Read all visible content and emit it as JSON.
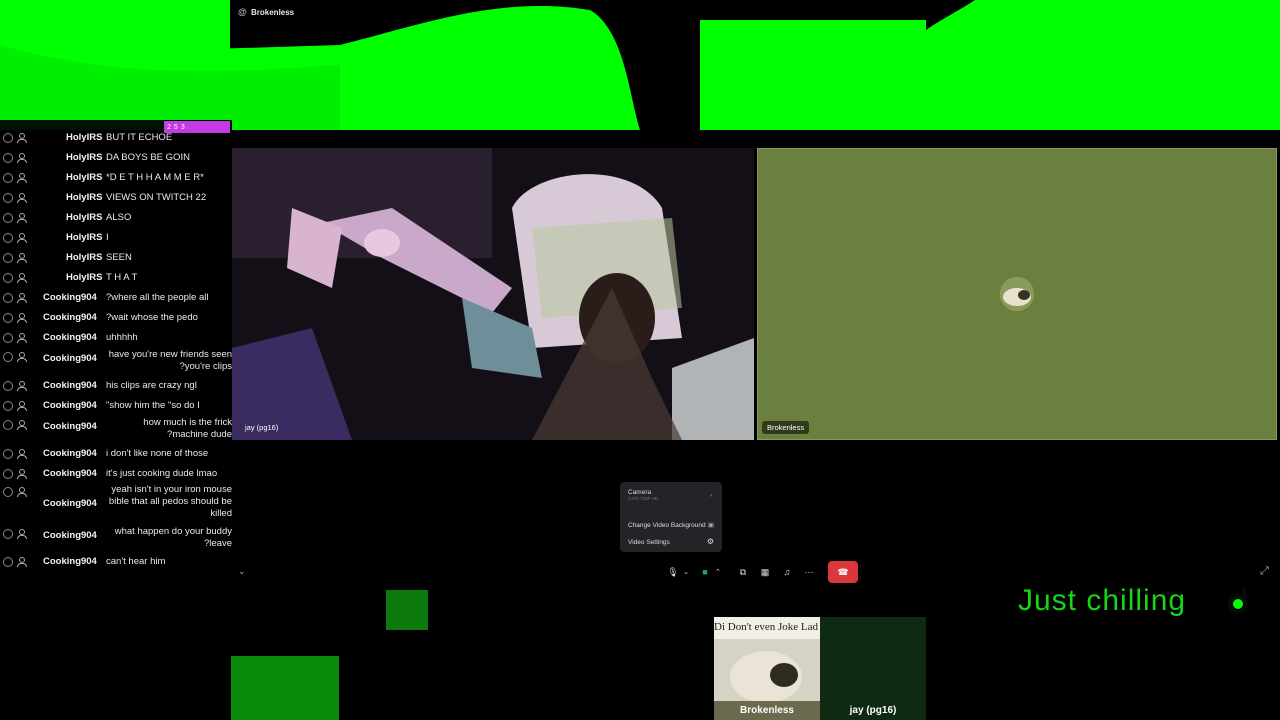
{
  "header": {
    "title": "Brokenless"
  },
  "chat": {
    "badges": [
      "2",
      "5",
      "3"
    ],
    "lines": [
      {
        "user": "HolyIRS",
        "msg": "BUT IT ECHOE"
      },
      {
        "user": "HolyIRS",
        "msg": "DA BOYS BE GOIN"
      },
      {
        "user": "HolyIRS",
        "msg": "*D E T H H A M M E R*"
      },
      {
        "user": "HolyIRS",
        "msg": "VIEWS ON TWITCH 22"
      },
      {
        "user": "HolyIRS",
        "msg": "ALSO"
      },
      {
        "user": "HolyIRS",
        "msg": "I"
      },
      {
        "user": "HolyIRS",
        "msg": "SEEN"
      },
      {
        "user": "HolyIRS",
        "msg": "T H A T"
      },
      {
        "user": "Cooking904",
        "msg": "?where all the people all"
      },
      {
        "user": "Cooking904",
        "msg": "?wait whose the pedo"
      },
      {
        "user": "Cooking904",
        "msg": "uhhhhh"
      },
      {
        "user": "Cooking904",
        "msg": "have you're new friends seen",
        "msg2": "?you're clips"
      },
      {
        "user": "Cooking904",
        "msg": "his clips are crazy ngl"
      },
      {
        "user": "Cooking904",
        "msg": "\"show him the \"so do I"
      },
      {
        "user": "Cooking904",
        "msg": "how much is the frick",
        "msg2": "?machine dude"
      },
      {
        "user": "Cooking904",
        "msg": "i don't like none of those"
      },
      {
        "user": "Cooking904",
        "msg": "it's just cooking dude lmao"
      },
      {
        "user": "Cooking904",
        "msg": "yeah isn't in your iron mouse",
        "msg2": "bible that all pedos should be",
        "msg3": "killed"
      },
      {
        "user": "Cooking904",
        "msg": "what happen do your buddy",
        "msg2": "?leave"
      },
      {
        "user": "Cooking904",
        "msg": "can't hear him"
      }
    ]
  },
  "tiles": {
    "jay_label": "jay (pg16)",
    "brokenless_label": "Brokenless"
  },
  "video_menu": {
    "camera_label": "Camera",
    "camera_device": "C270 720P HD",
    "background_label": "Change Video Background",
    "settings_label": "Video Settings"
  },
  "thumbnails": {
    "brokenless_name": "Brokenless",
    "brokenless_caption": "Di Don't even Joke Lad",
    "jay_name": "jay (pg16)"
  },
  "status": {
    "text": "Just chilling"
  },
  "colors": {
    "greenscreen": "#00ff00",
    "hangup": "#da373c",
    "tile_bg": "#6b803e"
  }
}
